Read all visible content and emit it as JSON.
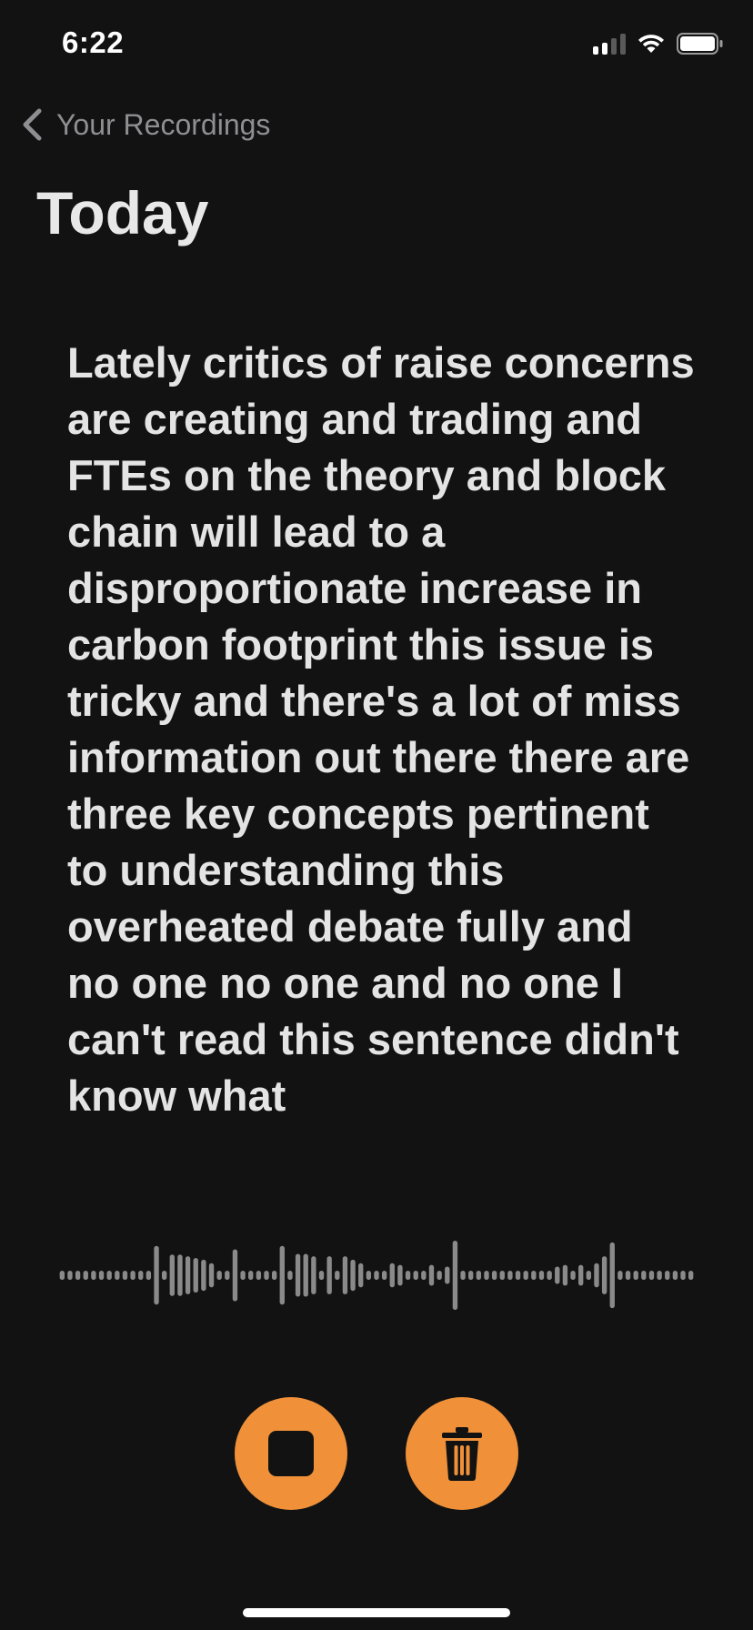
{
  "status_bar": {
    "time": "6:22",
    "signal_bars_active": 2,
    "signal_bars_total": 4,
    "battery_level": 1.0,
    "icons": [
      "signal-icon",
      "wifi-icon",
      "battery-icon"
    ]
  },
  "nav": {
    "back_label": "Your Recordings",
    "back_icon": "chevron-left-icon"
  },
  "header": {
    "title": "Today"
  },
  "transcript": {
    "text": "Lately critics of raise concerns are creating and trading and FTEs on the theory and block chain will lead to a disproportionate increase in carbon footprint this issue is tricky and there's a lot of miss information out there there are three key concepts pertinent to understanding this overheated debate fully and no one no one and no one I can't read this sentence didn't know what"
  },
  "waveform": {
    "bar_color": "#8a8a8a",
    "levels": [
      0.12,
      0.12,
      0.12,
      0.12,
      0.12,
      0.12,
      0.12,
      0.12,
      0.12,
      0.12,
      0.12,
      0.12,
      0.85,
      0.12,
      0.6,
      0.6,
      0.55,
      0.5,
      0.45,
      0.35,
      0.12,
      0.12,
      0.75,
      0.12,
      0.12,
      0.12,
      0.12,
      0.12,
      0.85,
      0.12,
      0.62,
      0.62,
      0.55,
      0.12,
      0.55,
      0.12,
      0.55,
      0.45,
      0.35,
      0.12,
      0.12,
      0.12,
      0.35,
      0.3,
      0.12,
      0.12,
      0.12,
      0.3,
      0.12,
      0.25,
      1.0,
      0.12,
      0.12,
      0.12,
      0.12,
      0.12,
      0.12,
      0.12,
      0.12,
      0.12,
      0.12,
      0.12,
      0.12,
      0.25,
      0.3,
      0.12,
      0.3,
      0.12,
      0.35,
      0.55,
      0.95,
      0.12,
      0.12,
      0.12,
      0.12,
      0.12,
      0.12,
      0.12,
      0.12,
      0.12,
      0.12
    ]
  },
  "controls": {
    "accent_color": "#f0913a",
    "stop_icon": "stop-icon",
    "trash_icon": "trash-icon"
  },
  "colors": {
    "background": "#121212",
    "text": "#e4e4e4",
    "secondary_text": "#8e8e93"
  }
}
